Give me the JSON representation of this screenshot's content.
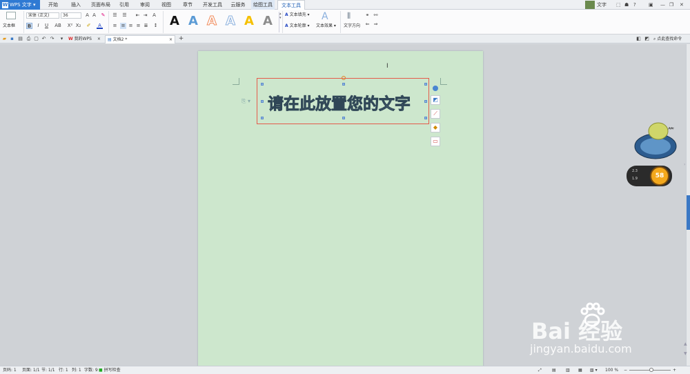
{
  "app": {
    "name": "WPS 文字"
  },
  "menu_tabs": [
    "开始",
    "插入",
    "页面布局",
    "引用",
    "审阅",
    "视图",
    "章节",
    "开发工具",
    "云服务",
    "绘图工具",
    "文本工具"
  ],
  "active_tab": "文本工具",
  "top_right": {
    "user_label": "文字",
    "help": "?"
  },
  "ribbon": {
    "textbox_label": "文本框",
    "font_name": "宋体 (正文)",
    "font_size": "36",
    "text_fill": "文本填充",
    "text_outline": "文本轮廓",
    "text_effect": "文本效果",
    "text_direction": "文字方向",
    "style_gallery": [
      {
        "glyph": "A",
        "color": "#111111"
      },
      {
        "glyph": "A",
        "color": "#5b9bd5"
      },
      {
        "glyph": "A",
        "color": "#f28a58"
      },
      {
        "glyph": "A",
        "color": "#8ab0de"
      },
      {
        "glyph": "A",
        "color": "#f5c000"
      },
      {
        "glyph": "A",
        "color": "#8c8c8c"
      }
    ]
  },
  "doc_tabs": [
    {
      "label": "我的WPS"
    },
    {
      "label": "文档2 *"
    }
  ],
  "find_command": "点此查找命令",
  "document": {
    "textbox_text": "请在此放置您的文字"
  },
  "status_bar": {
    "page": "页码: 1",
    "pages": "页面: 1/1",
    "section": "节: 1/1",
    "row": "行: 1",
    "col": "列: 1",
    "chars": "字数: 9",
    "spell": "拼写检查",
    "zoom": "100 %"
  },
  "widget": {
    "up": "2.3",
    "down": "1.9",
    "score": "58"
  },
  "watermark": {
    "brand": "Bai 经验",
    "url": "jingyan.baidu.com"
  }
}
